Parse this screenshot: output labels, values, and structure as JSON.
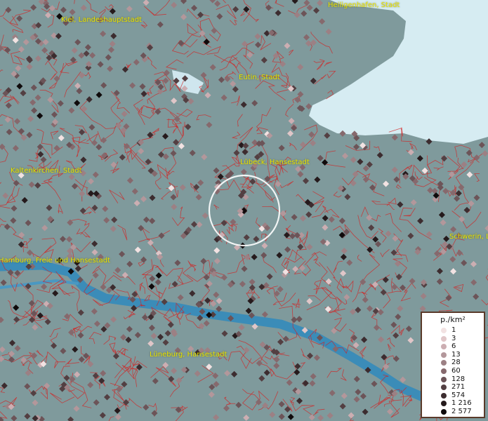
{
  "map": {
    "place_labels": [
      {
        "id": "heiligenhafen",
        "text": "Heiligenhafen, Stadt"
      },
      {
        "id": "kiel",
        "text": "Kiel, Landeshauptstadt"
      },
      {
        "id": "eutin",
        "text": "Eutin, Stadt"
      },
      {
        "id": "kaltenkirchen",
        "text": "Kaltenkirchen, Stadt"
      },
      {
        "id": "luebeck",
        "text": "Lübeck, Hansestadt"
      },
      {
        "id": "schwerin",
        "text": "Schwerin, L"
      },
      {
        "id": "hamburg",
        "text": "Hamburg, Freie und Hansestadt"
      },
      {
        "id": "lueneburg",
        "text": "Lüneburg, Hansestadt"
      }
    ],
    "colors": {
      "land": "#7f9a9c",
      "sea": "#d6ecf2",
      "river": "#3b8cb8",
      "boundary": "#d42020",
      "label": "#e8e200",
      "focus_ring": "#ffffff"
    }
  },
  "legend": {
    "title": "p./km²",
    "classes": [
      {
        "label": "1",
        "color": "#f2e2e2"
      },
      {
        "label": "3",
        "color": "#e0c6c8"
      },
      {
        "label": "6",
        "color": "#ccaeb2"
      },
      {
        "label": "13",
        "color": "#b3979b"
      },
      {
        "label": "28",
        "color": "#9c8084"
      },
      {
        "label": "60",
        "color": "#86696d"
      },
      {
        "label": "128",
        "color": "#6c5458"
      },
      {
        "label": "271",
        "color": "#533f42"
      },
      {
        "label": "574",
        "color": "#3c2c2f"
      },
      {
        "label": "1 216",
        "color": "#251a1c"
      },
      {
        "label": "2 577",
        "color": "#0f0a0b"
      }
    ]
  }
}
